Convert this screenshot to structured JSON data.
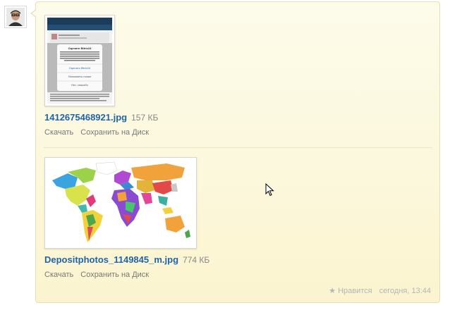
{
  "post": {
    "author_avatar": "user-avatar",
    "files": [
      {
        "name": "1412675468921.jpg",
        "size": "157 КБ",
        "download_label": "Скачать",
        "save_label": "Сохранить на Диск",
        "preview": {
          "title": "Оцените Bitrix24",
          "text": "Если вам нравится приложение Bitrix24, пожалуйста, оцените его в AppStore. Это займет у Вас не больше одной минуты. Спасибо за поддержку!",
          "rate_button": "Оценить Bitrix24",
          "later_button": "Напомнить позже",
          "no_button": "Нет, спасибо"
        }
      },
      {
        "name": "Depositphotos_1149845_m.jpg",
        "size": "774 КБ",
        "download_label": "Скачать",
        "save_label": "Сохранить на Диск"
      }
    ],
    "footer": {
      "like_label": "Нравится",
      "time": "сегодня, 13:44"
    }
  },
  "colors": {
    "link": "#1f64a8",
    "bubble_bg": "#fcf8dd",
    "bubble_border": "#e6dfb8"
  }
}
